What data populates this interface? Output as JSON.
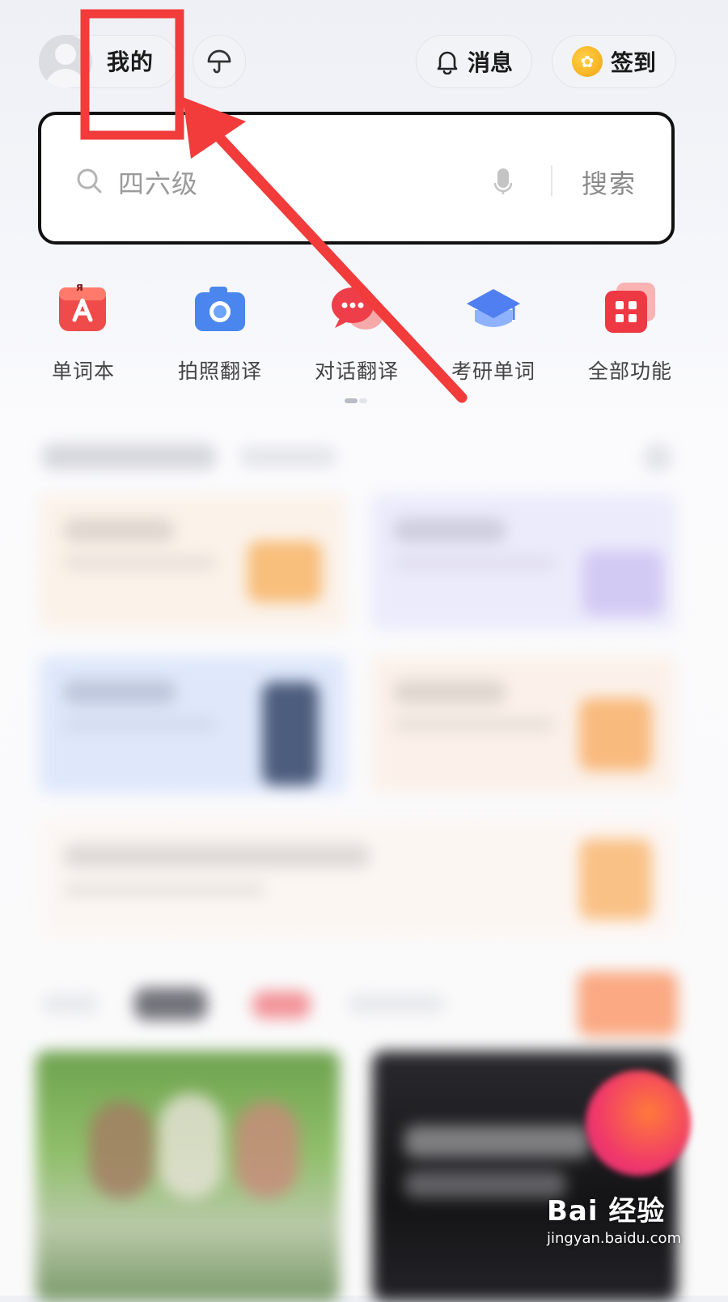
{
  "header": {
    "mine_label": "我的",
    "messages_label": "消息",
    "signin_label": "签到"
  },
  "search": {
    "placeholder": "四六级",
    "button_label": "搜索"
  },
  "quick_functions": [
    {
      "label": "单词本",
      "icon": "wordbook-icon"
    },
    {
      "label": "拍照翻译",
      "icon": "camera-icon"
    },
    {
      "label": "对话翻译",
      "icon": "chat-bubble-icon"
    },
    {
      "label": "考研单词",
      "icon": "graduation-cap-icon"
    },
    {
      "label": "全部功能",
      "icon": "grid-icon"
    }
  ],
  "watermark": {
    "main": "Bai 经验",
    "sub": "jingyan.baidu.com"
  },
  "colors": {
    "annotation_red": "#f23b3b",
    "search_border": "#111111"
  }
}
